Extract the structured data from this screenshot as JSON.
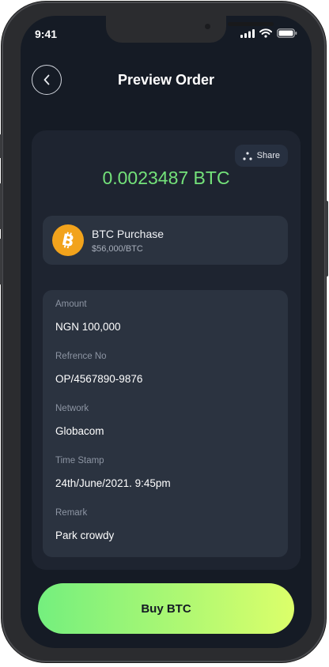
{
  "status_bar": {
    "time": "9:41"
  },
  "header": {
    "title": "Preview Order"
  },
  "order": {
    "share_label": "Share",
    "amount": "0.0023487 BTC",
    "purchase_title": "BTC Purchase",
    "purchase_rate": "$56,000/BTC",
    "details": [
      {
        "label": "Amount",
        "value": "NGN 100,000"
      },
      {
        "label": "Refrence No",
        "value": "OP/4567890-9876"
      },
      {
        "label": "Network",
        "value": "Globacom"
      },
      {
        "label": "Time Stamp",
        "value": "24th/June/2021. 9:45pm"
      },
      {
        "label": "Remark",
        "value": "Park crowdy"
      }
    ]
  },
  "buy_button": {
    "label": "Buy BTC"
  },
  "colors": {
    "background": "#151b25",
    "card": "#1e2430",
    "accent_green": "#74e27a",
    "button_gradient_start": "#74ef7e",
    "button_gradient_end": "#dcff6a",
    "bitcoin_orange": "#f2a31c"
  },
  "icons": [
    "back-chevron-icon",
    "share-icon",
    "bitcoin-icon",
    "signal-icon",
    "wifi-icon",
    "battery-icon"
  ]
}
